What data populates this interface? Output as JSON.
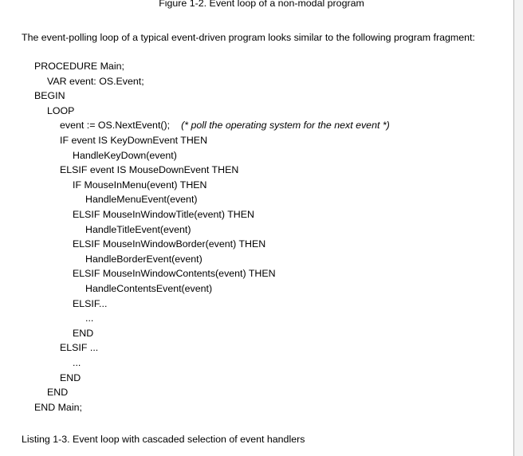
{
  "figure_caption": "Figure 1-2. Event loop of a non-modal program",
  "intro_paragraph": "The event-polling loop of a typical event-driven program looks similar to the following program fragment:",
  "code_lines": [
    {
      "text": "PROCEDURE Main;",
      "indent": 0
    },
    {
      "text": "VAR event: OS.Event;",
      "indent": 1
    },
    {
      "text": "BEGIN",
      "indent": 0
    },
    {
      "text": "LOOP",
      "indent": 1
    },
    {
      "text": "event := OS.NextEvent();",
      "indent": 2,
      "comment": "(* poll the operating system for the next event *)"
    },
    {
      "text": "IF event IS KeyDownEvent THEN",
      "indent": 2
    },
    {
      "text": "HandleKeyDown(event)",
      "indent": 3
    },
    {
      "text": "ELSIF event IS MouseDownEvent THEN",
      "indent": 2
    },
    {
      "text": "IF MouseInMenu(event) THEN",
      "indent": 3
    },
    {
      "text": "HandleMenuEvent(event)",
      "indent": 4
    },
    {
      "text": "ELSIF MouseInWindowTitle(event) THEN",
      "indent": 3
    },
    {
      "text": "HandleTitleEvent(event)",
      "indent": 4
    },
    {
      "text": "ELSIF MouseInWindowBorder(event) THEN",
      "indent": 3
    },
    {
      "text": "HandleBorderEvent(event)",
      "indent": 4
    },
    {
      "text": "ELSIF MouseInWindowContents(event) THEN",
      "indent": 3
    },
    {
      "text": "HandleContentsEvent(event)",
      "indent": 4
    },
    {
      "text": "ELSIF...",
      "indent": 3
    },
    {
      "text": "...",
      "indent": 4
    },
    {
      "text": "END",
      "indent": 3
    },
    {
      "text": "ELSIF ...",
      "indent": 2
    },
    {
      "text": "...",
      "indent": 3
    },
    {
      "text": "END",
      "indent": 2
    },
    {
      "text": "END",
      "indent": 1
    },
    {
      "text": "END Main;",
      "indent": 0
    }
  ],
  "listing_caption": "Listing 1-3. Event loop with cascaded selection of event handlers"
}
